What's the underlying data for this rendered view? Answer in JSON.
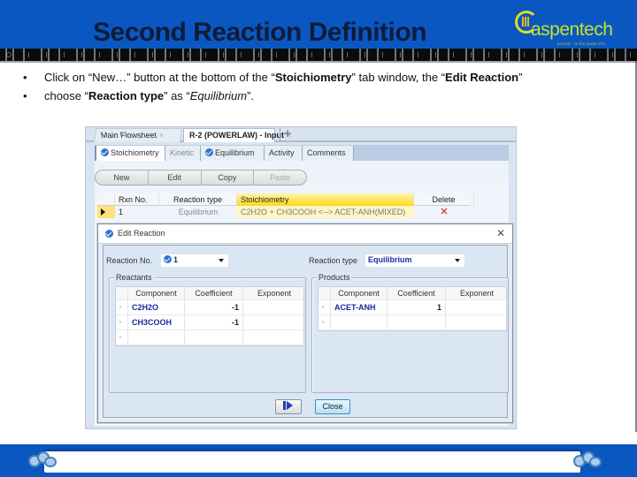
{
  "slide": {
    "title": "Second Reaction Definition",
    "logo": {
      "name": "aspentech",
      "tagline": "process - to the power of e"
    },
    "bullets": [
      {
        "marker": "•",
        "parts": [
          {
            "text": "Click on “New…” button at the bottom of the “",
            "style": "normal"
          },
          {
            "text": "Stoichiometry",
            "style": "bold"
          },
          {
            "text": "” tab window, the “",
            "style": "normal"
          },
          {
            "text": "Edit Reaction",
            "style": "bold"
          },
          {
            "text": "”",
            "style": "normal"
          }
        ]
      },
      {
        "marker": "•",
        "parts": [
          {
            "text": "choose “",
            "style": "normal"
          },
          {
            "text": "Reaction type",
            "style": "bold"
          },
          {
            "text": "” as “",
            "style": "normal"
          },
          {
            "text": "Equilibrium",
            "style": "italic"
          },
          {
            "text": "”.",
            "style": "normal"
          }
        ]
      }
    ]
  },
  "app": {
    "doc_tabs": [
      {
        "label": "Main Flowsheet",
        "active": false
      },
      {
        "label": "R-2 (POWERLAW) - Input",
        "active": true
      }
    ],
    "new_tab_label": "+",
    "tab_close_glyph": "×",
    "form_tabs": [
      {
        "label": "Stoichiometry",
        "status": "complete",
        "active": true
      },
      {
        "label": "Kinetic",
        "status": "none",
        "active": false
      },
      {
        "label": "Equilibrium",
        "status": "complete",
        "active": false
      },
      {
        "label": "Activity",
        "status": "none",
        "active": false
      },
      {
        "label": "Comments",
        "status": "none",
        "active": false
      }
    ],
    "buttons": {
      "new": "New",
      "edit": "Edit",
      "copy": "Copy",
      "paste": "Paste"
    },
    "reaction_table": {
      "columns": [
        "Rxn No.",
        "Reaction type",
        "Stoichiometry",
        "Delete"
      ],
      "rows": [
        {
          "rxn_no": "1",
          "type": "Equilibrium",
          "stoichiometry": "C2H2O + CH3COOH <--> ACET-ANH(MIXED)",
          "delete_icon": "✕"
        }
      ]
    }
  },
  "dialog": {
    "title": "Edit Reaction",
    "close_glyph": "✕",
    "reaction_no_label": "Reaction No.",
    "reaction_no_value": "1",
    "reaction_type_label": "Reaction type",
    "reaction_type_value": "Equilibrium",
    "reactants": {
      "legend": "Reactants",
      "columns": [
        "Component",
        "Coefficient",
        "Exponent"
      ],
      "rows": [
        {
          "component": "C2H2O",
          "coefficient": "-1",
          "exponent": ""
        },
        {
          "component": "CH3COOH",
          "coefficient": "-1",
          "exponent": ""
        },
        {
          "component": "",
          "coefficient": "",
          "exponent": ""
        }
      ]
    },
    "products": {
      "legend": "Products",
      "columns": [
        "Component",
        "Coefficient",
        "Exponent"
      ],
      "rows": [
        {
          "component": "ACET-ANH",
          "coefficient": "1",
          "exponent": ""
        },
        {
          "component": "",
          "coefficient": "",
          "exponent": ""
        }
      ]
    },
    "next_button_icon": "next-arrow",
    "close_button": "Close"
  }
}
